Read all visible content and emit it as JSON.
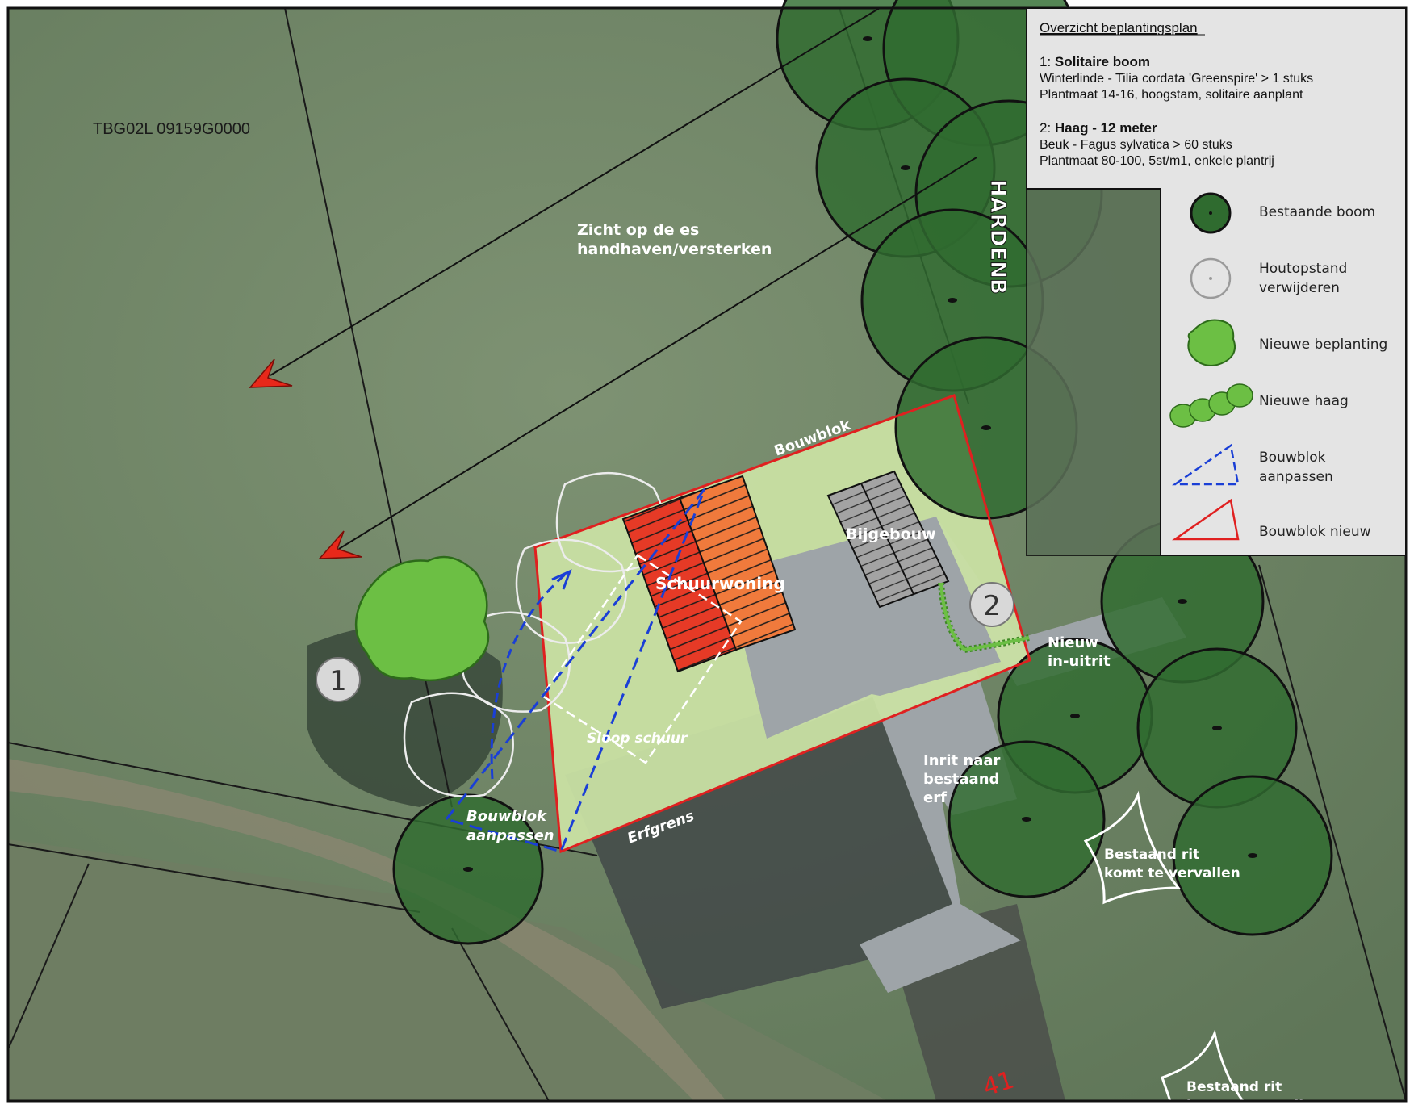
{
  "map": {
    "parcel_label": "TBG02L 09159G0000",
    "view_label_line1": "Zicht op de es",
    "view_label_line2": "handhaven/versterken",
    "road_name": "HARDENB",
    "house_number": "41",
    "marker_1": "1",
    "marker_2": "2",
    "labels": {
      "bouwblok": "Bouwblok",
      "schuurwoning": "Schuurwoning",
      "bijgebouw": "Bijgebouw",
      "sloop_schuur": "Sloop schuur",
      "erfgrens": "Erfgrens",
      "bouwblok_aanpassen_1": "Bouwblok",
      "bouwblok_aanpassen_2": "aanpassen",
      "nieuw_inuitrit_1": "Nieuw",
      "nieuw_inuitrit_2": "in-uitrit",
      "inrit_1": "Inrit naar",
      "inrit_2": "bestaand",
      "inrit_3": "erf",
      "bestaand_rit_1": "Bestaand rit",
      "bestaand_rit_2": "komt te vervallen",
      "bestaand_rit_bottom_1": "Bestaand rit",
      "bestaand_rit_bottom_2": "komt te vervallen"
    }
  },
  "legend": {
    "title": "Overzicht beplantingsplan",
    "item1_prefix": "1: ",
    "item1_title": "Solitaire boom",
    "item1_line1": "Winterlinde - Tilia cordata 'Greenspire' > 1 stuks",
    "item1_line2": "Plantmaat 14-16, hoogstam, solitaire aanplant",
    "item2_prefix": "2: ",
    "item2_title": "Haag - 12 meter",
    "item2_line1": "Beuk - Fagus sylvatica > 60 stuks",
    "item2_line2": "Plantmaat 80-100, 5st/m1, enkele plantrij",
    "symbols": [
      {
        "line1": "Bestaande boom",
        "line2": ""
      },
      {
        "line1": "Houtopstand",
        "line2": "verwijderen"
      },
      {
        "line1": "Nieuwe beplanting",
        "line2": ""
      },
      {
        "line1": "Nieuwe haag",
        "line2": ""
      },
      {
        "line1": "Bouwblok",
        "line2": "aanpassen"
      },
      {
        "line1": "Bouwblok nieuw",
        "line2": ""
      }
    ]
  },
  "colors": {
    "existing_tree": "#2f6b2f",
    "new_planting": "#6cbf44",
    "bouwblok_new": "#e02020",
    "bouwblok_adjust": "#1a3fd6",
    "schuurwoning_a": "#e8402a",
    "schuurwoning_b": "#f07a3c",
    "bijgebouw": "#9a9a9a",
    "lawn": "#c9e0a3",
    "pavement": "#9ea4a8"
  }
}
